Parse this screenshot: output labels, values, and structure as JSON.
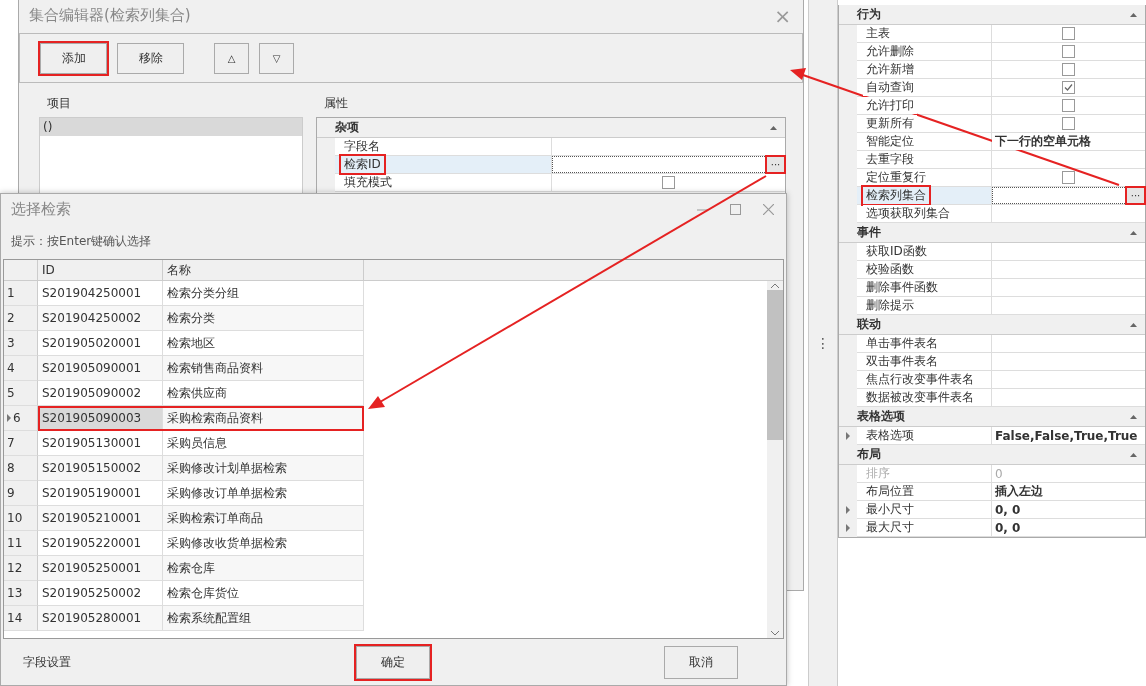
{
  "collection_editor": {
    "title": "集合编辑器(检索列集合)",
    "close": "×",
    "toolbar": [
      {
        "label": "添加",
        "kind": "text",
        "highlighted": true
      },
      {
        "label": "移除",
        "kind": "text",
        "highlighted": false
      },
      {
        "label": "△",
        "kind": "icon",
        "highlighted": false
      },
      {
        "label": "▽",
        "kind": "icon",
        "highlighted": false
      }
    ],
    "items_label": "项目",
    "items": [
      {
        "label": "()",
        "selected": true
      }
    ],
    "properties_label": "属性",
    "property_grid": [
      {
        "name": "杂项",
        "rows": [
          {
            "name": "字段名",
            "kind": "text",
            "focused": false,
            "highlighted": false
          },
          {
            "name": "检索ID",
            "kind": "editor",
            "button": "···",
            "focused": true,
            "highlighted": true
          },
          {
            "name": "填充模式",
            "kind": "checkbox",
            "checked": false,
            "focused": false,
            "highlighted": false
          }
        ]
      }
    ]
  },
  "property_panel": {
    "grip": "⋮",
    "categories": [
      {
        "name": "行为",
        "rows": [
          {
            "name": "主表",
            "kind": "checkbox",
            "checked": false
          },
          {
            "name": "允许删除",
            "kind": "checkbox",
            "checked": false
          },
          {
            "name": "允许新增",
            "kind": "checkbox",
            "checked": false
          },
          {
            "name": "自动查询",
            "kind": "checkbox",
            "checked": true
          },
          {
            "name": "允许打印",
            "kind": "checkbox",
            "checked": false
          },
          {
            "name": "更新所有",
            "kind": "checkbox",
            "checked": false
          },
          {
            "name": "智能定位",
            "kind": "text",
            "value": "下一行的空单元格",
            "modified": true
          },
          {
            "name": "去重字段",
            "kind": "text"
          },
          {
            "name": "定位重复行",
            "kind": "checkbox",
            "checked": false
          },
          {
            "name": "检索列集合",
            "kind": "editor",
            "button": "···",
            "focused": true,
            "highlighted": true
          },
          {
            "name": "选项获取列集合",
            "kind": "text"
          }
        ]
      },
      {
        "name": "事件",
        "rows": [
          {
            "name": "获取ID函数",
            "kind": "text"
          },
          {
            "name": "校验函数",
            "kind": "text"
          },
          {
            "name": "删除事件函数",
            "kind": "text"
          },
          {
            "name": "删除提示",
            "kind": "text"
          }
        ]
      },
      {
        "name": "联动",
        "rows": [
          {
            "name": "单击事件表名",
            "kind": "text"
          },
          {
            "name": "双击事件表名",
            "kind": "text"
          },
          {
            "name": "焦点行改变事件表名",
            "kind": "text"
          },
          {
            "name": "数据被改变事件表名",
            "kind": "text"
          }
        ]
      },
      {
        "name": "表格选项",
        "rows": [
          {
            "name": "表格选项",
            "kind": "text",
            "value": "False,False,True,True",
            "modified": true,
            "expandable": true
          }
        ]
      },
      {
        "name": "布局",
        "rows": [
          {
            "name": "排序",
            "kind": "text",
            "value": "0",
            "disabled": true
          },
          {
            "name": "布局位置",
            "kind": "text",
            "value": "插入左边",
            "modified": true
          },
          {
            "name": "最小尺寸",
            "kind": "text",
            "value": "0, 0",
            "modified": true,
            "expandable": true
          },
          {
            "name": "最大尺寸",
            "kind": "text",
            "value": "0, 0",
            "modified": true,
            "expandable": true
          }
        ]
      }
    ]
  },
  "search_dialog": {
    "title": "选择检索",
    "hint": "提示：按Enter键确认选择",
    "columns": [
      "ID",
      "名称"
    ],
    "rows": [
      {
        "number": "1",
        "id": "S201904250001",
        "name": "检索分类分组",
        "selected": false,
        "highlighted": false
      },
      {
        "number": "2",
        "id": "S201904250002",
        "name": "检索分类",
        "selected": false,
        "highlighted": false
      },
      {
        "number": "3",
        "id": "S201905020001",
        "name": "检索地区",
        "selected": false,
        "highlighted": false
      },
      {
        "number": "4",
        "id": "S201905090001",
        "name": "检索销售商品资料",
        "selected": false,
        "highlighted": false
      },
      {
        "number": "5",
        "id": "S201905090002",
        "name": "检索供应商",
        "selected": false,
        "highlighted": false
      },
      {
        "number": "6",
        "id": "S201905090003",
        "name": "采购检索商品资料",
        "selected": true,
        "highlighted": true
      },
      {
        "number": "7",
        "id": "S201905130001",
        "name": "采购员信息",
        "selected": false,
        "highlighted": false
      },
      {
        "number": "8",
        "id": "S201905150002",
        "name": "采购修改计划单据检索",
        "selected": false,
        "highlighted": false
      },
      {
        "number": "9",
        "id": "S201905190001",
        "name": "采购修改订单单据检索",
        "selected": false,
        "highlighted": false
      },
      {
        "number": "10",
        "id": "S201905210001",
        "name": "采购检索订单商品",
        "selected": false,
        "highlighted": false
      },
      {
        "number": "11",
        "id": "S201905220001",
        "name": "采购修改收货单据检索",
        "selected": false,
        "highlighted": false
      },
      {
        "number": "12",
        "id": "S201905250001",
        "name": "检索仓库",
        "selected": false,
        "highlighted": false
      },
      {
        "number": "13",
        "id": "S201905250002",
        "name": "检索仓库货位",
        "selected": false,
        "highlighted": false
      },
      {
        "number": "14",
        "id": "S201905280001",
        "name": "检索系统配置组",
        "selected": false,
        "highlighted": false
      }
    ],
    "footer_label": "字段设置",
    "buttons": [
      {
        "label": "确定",
        "highlighted": true
      },
      {
        "label": "取消",
        "highlighted": false
      }
    ]
  }
}
